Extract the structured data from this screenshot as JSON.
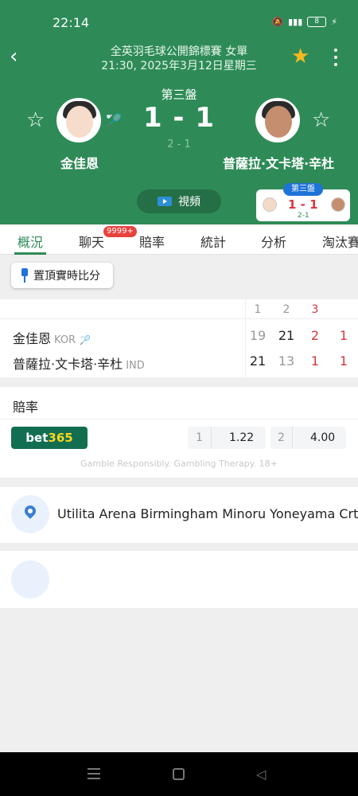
{
  "status_bar": {
    "time": "22:14",
    "battery": "8"
  },
  "header": {
    "title": "全英羽毛球公開錦標賽 女單",
    "subtitle": "21:30, 2025年3月12日星期三",
    "set_label": "第三盤",
    "score": "1 - 1",
    "sub_score": "2 - 1",
    "player1": {
      "name": "金佳恩"
    },
    "player2": {
      "name": "普薩拉·文卡塔·辛杜"
    },
    "video_label": "視頻",
    "mini_card": {
      "tag": "第三盤",
      "score": "1 - 1",
      "sub": "2-1"
    }
  },
  "tabs": [
    {
      "label": "概況"
    },
    {
      "label": "聊天",
      "badge": "9999+"
    },
    {
      "label": "賠率"
    },
    {
      "label": "統計"
    },
    {
      "label": "分析"
    },
    {
      "label": "淘汰賽"
    }
  ],
  "pin_button": {
    "label": "置頂實時比分"
  },
  "scoreboard": {
    "headers": [
      "1",
      "2",
      "3"
    ],
    "rows": [
      {
        "name": "金佳恩",
        "country": "KOR",
        "scores": [
          "19",
          "21",
          "2"
        ],
        "sets": "1"
      },
      {
        "name": "普薩拉·文卡塔·辛杜",
        "country": "IND",
        "scores": [
          "21",
          "13",
          "1"
        ],
        "sets": "1"
      }
    ]
  },
  "odds": {
    "title": "賠率",
    "bookmaker": {
      "part1": "bet",
      "part2": "365"
    },
    "options": [
      {
        "label": "1",
        "value": "1.22"
      },
      {
        "label": "2",
        "value": "4.00"
      }
    ],
    "disclaimer": "Gamble Responsibly. Gambling Therapy. 18+"
  },
  "venue": {
    "name": "Utilita Arena Birmingham Minoru Yoneyama Crt"
  },
  "colors": {
    "primary": "#2e8b57",
    "accent_red": "#d9363e",
    "star": "#f6b920",
    "link_blue": "#1e73d8"
  }
}
